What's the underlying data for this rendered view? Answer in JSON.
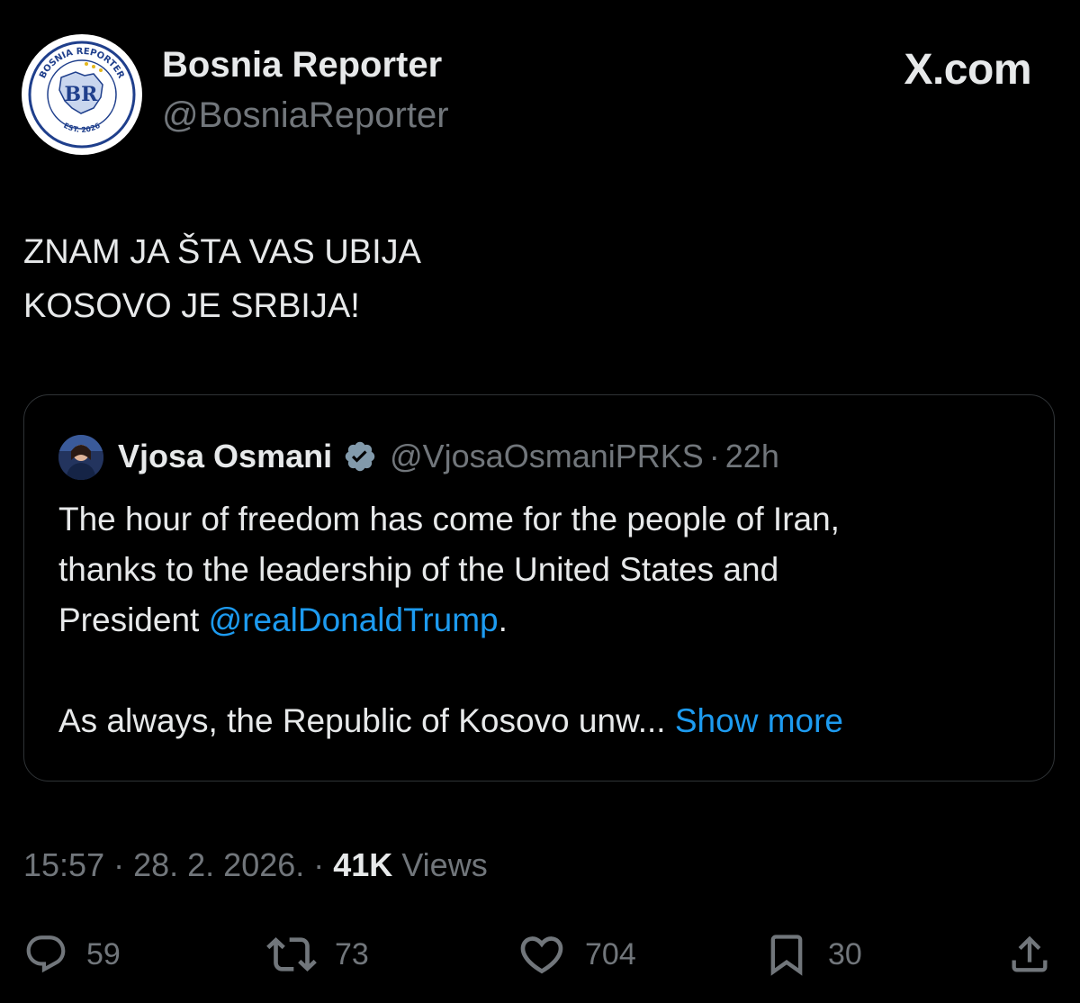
{
  "brand": "X.com",
  "author": {
    "name": "Bosnia Reporter",
    "handle": "@BosniaReporter",
    "avatar_icon": "bosnia-reporter-logo",
    "avatar_text": {
      "top": "BOSNIA REPORTER",
      "monogram": "BR",
      "bottom": "EST. 2026"
    }
  },
  "tweet": {
    "lines": [
      "ZNAM JA ŠTA VAS UBIJA",
      "KOSOVO JE SRBIJA!"
    ]
  },
  "quote": {
    "name": "Vjosa Osmani",
    "handle": "@VjosaOsmaniPRKS",
    "separator": "·",
    "time": "22h",
    "line1": "The hour of freedom has come for the people of Iran,",
    "line2": "thanks to the leadership of the United States and",
    "line3_prefix": "President ",
    "line3_mention": "@realDonaldTrump",
    "line3_suffix": ".",
    "line4_text": "As always, the Republic of Kosovo unw...",
    "show_more": "Show more"
  },
  "meta": {
    "time": "15:57",
    "dot1": " · ",
    "date": "28. 2. 2026.",
    "dot2": " · ",
    "views_count": "41K",
    "views_label": " Views"
  },
  "actions": {
    "replies": "59",
    "reposts": "73",
    "likes": "704",
    "bookmarks": "30"
  },
  "colors": {
    "background": "#000000",
    "text": "#e7e9ea",
    "secondary": "#71767b",
    "link": "#1d9bf0",
    "border": "#2f3336"
  }
}
